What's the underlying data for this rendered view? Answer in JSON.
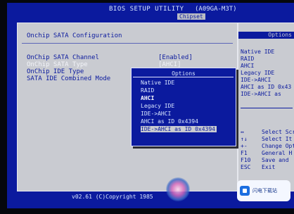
{
  "header": {
    "title": "BIOS SETUP UTILITY",
    "model": "(A09GA-M3T)",
    "active_tab": "Chipset"
  },
  "main": {
    "section_title": "Onchip SATA Configuration",
    "rows": [
      {
        "label": "OnChip SATA Channel",
        "value": "[Enabled]"
      },
      {
        "label": "OnChip SATA Type",
        "value": "[AHCI]"
      },
      {
        "label": "OnChip IDE Type",
        "value": ""
      },
      {
        "label": "SATA IDE Combined Mode",
        "value": ""
      }
    ]
  },
  "popup": {
    "title": "Options",
    "options": [
      "Native IDE",
      "RAID",
      "AHCI",
      "Legacy IDE",
      "IDE->AHCI",
      "AHCI as ID 0x4394",
      "IDE->AHCI as ID 0x4394"
    ],
    "highlighted_index": 2
  },
  "side": {
    "title": "Options",
    "options": [
      "Native IDE",
      "RAID",
      "AHCI",
      "Legacy IDE",
      "IDE->AHCI",
      "AHCI as ID 0x43",
      "IDE->AHCI as"
    ],
    "keys": [
      {
        "key": "↔",
        "desc": "Select Scr"
      },
      {
        "key": "↑↓",
        "desc": "Select It"
      },
      {
        "key": "+-",
        "desc": "Change Opt"
      },
      {
        "key": "F1",
        "desc": "General H"
      },
      {
        "key": "F10",
        "desc": "Save and"
      },
      {
        "key": "ESC",
        "desc": "Exit"
      }
    ]
  },
  "footer": {
    "text": "v02.61 (C)Copyright 1985"
  },
  "watermark": {
    "text": "闪电下载站"
  },
  "colors": {
    "bios_blue": "#0b1a9e",
    "panel_gray": "#c9cbd1",
    "text_light": "#d8e6ff"
  }
}
